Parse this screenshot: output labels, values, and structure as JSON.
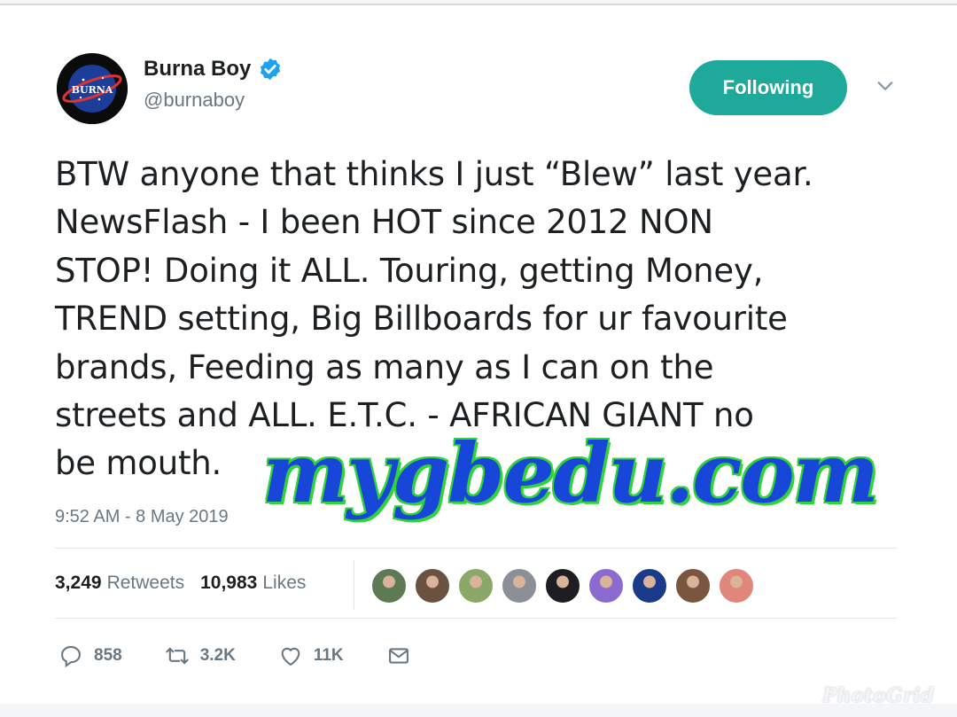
{
  "user": {
    "display_name": "Burna Boy",
    "handle": "@burnaboy",
    "avatar_text": "BURNA"
  },
  "follow_button": {
    "label": "Following"
  },
  "tweet": {
    "lines": [
      "BTW anyone that thinks I just “Blew” last year.",
      "NewsFlash - I been HOT since 2012 NON",
      "STOP! Doing it ALL. Touring, getting Money,",
      "TREND setting, Big Billboards for ur favourite",
      "brands, Feeding as many as I can on the",
      "streets and ALL. E.T.C. - AFRICAN GIANT no",
      "be mouth."
    ],
    "timestamp": "9:52 AM - 8 May 2019"
  },
  "stats": {
    "retweets_count": "3,249",
    "retweets_label": "Retweets",
    "likes_count": "10,983",
    "likes_label": "Likes"
  },
  "likers": [
    {
      "color": "#5e7a55"
    },
    {
      "color": "#6b5240"
    },
    {
      "color": "#8aa868"
    },
    {
      "color": "#8a8f98"
    },
    {
      "color": "#1e1e22"
    },
    {
      "color": "#8c6bd0"
    },
    {
      "color": "#1a3a8a"
    },
    {
      "color": "#7a5640"
    },
    {
      "color": "#e0867a"
    }
  ],
  "actions": {
    "reply_count": "858",
    "retweet_count": "3.2K",
    "like_count": "11K"
  },
  "watermark": "mygbedu.com",
  "photogrid_mark": "PhotoGrid",
  "colors": {
    "follow_bg": "#1ea99b",
    "verified": "#1da1f2",
    "watermark_fill": "#1846d8",
    "watermark_outline": "#2fd33a"
  }
}
